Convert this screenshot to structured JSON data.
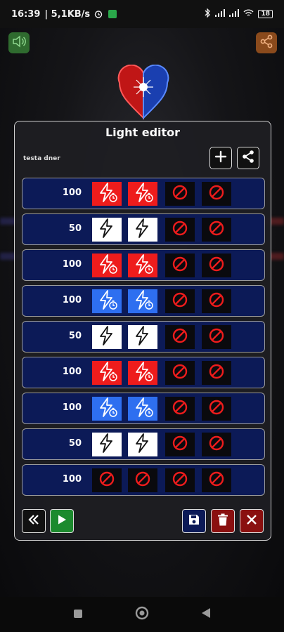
{
  "status_bar": {
    "time": "16:39",
    "speed": "| 5,1KB/s",
    "battery": "18"
  },
  "dialog": {
    "title": "Light editor",
    "preset_name": "testa dner"
  },
  "rows": [
    {
      "value": "100",
      "cells": [
        "red-flash",
        "red-flash",
        "off",
        "off"
      ]
    },
    {
      "value": "50",
      "cells": [
        "white-flash",
        "white-flash",
        "off",
        "off"
      ]
    },
    {
      "value": "100",
      "cells": [
        "red-flash",
        "red-flash",
        "off",
        "off"
      ]
    },
    {
      "value": "100",
      "cells": [
        "blue-flash",
        "blue-flash",
        "off",
        "off"
      ]
    },
    {
      "value": "50",
      "cells": [
        "white-flash",
        "white-flash",
        "off",
        "off"
      ]
    },
    {
      "value": "100",
      "cells": [
        "red-flash",
        "red-flash",
        "off",
        "off"
      ]
    },
    {
      "value": "100",
      "cells": [
        "blue-flash",
        "blue-flash",
        "off",
        "off"
      ]
    },
    {
      "value": "50",
      "cells": [
        "white-flash",
        "white-flash",
        "off",
        "off"
      ]
    },
    {
      "value": "100",
      "cells": [
        "off",
        "off",
        "off",
        "off"
      ]
    }
  ],
  "icons": {
    "flash": "lightning-bolt-icon",
    "timer": "stopwatch-icon",
    "off": "prohibited-icon",
    "add": "plus-icon",
    "share": "share-icon",
    "rewind": "double-chevron-left-icon",
    "play": "play-icon",
    "save": "floppy-disk-icon",
    "delete": "trash-icon",
    "close": "close-icon",
    "sound": "speaker-icon"
  },
  "colors": {
    "red": "#ee1c1c",
    "blue": "#2e6ff0",
    "white": "#ffffff",
    "row_bg": "#0c1a57",
    "play": "#1c8a2e",
    "danger": "#8a1010"
  }
}
